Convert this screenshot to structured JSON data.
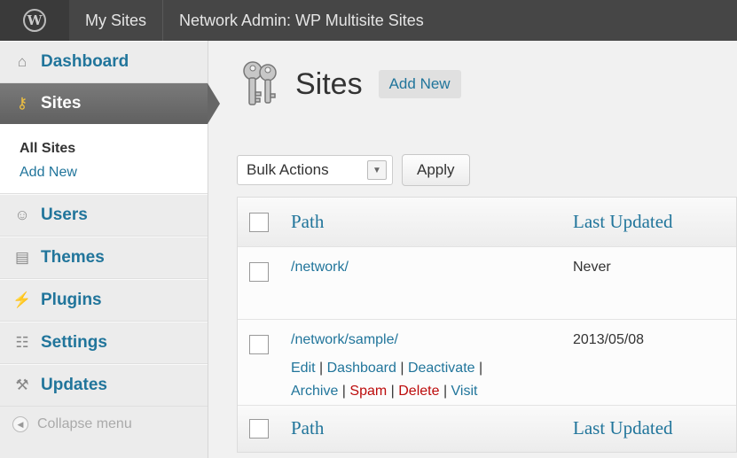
{
  "adminbar": {
    "logo_icon": "wordpress-logo-icon",
    "my_sites": "My Sites",
    "network_admin": "Network Admin: WP Multisite Sites"
  },
  "sidebar": {
    "items": [
      {
        "label": "Dashboard",
        "icon": "home-icon"
      },
      {
        "label": "Sites",
        "icon": "keys-icon",
        "active": true
      },
      {
        "label": "Users",
        "icon": "users-icon"
      },
      {
        "label": "Themes",
        "icon": "themes-icon"
      },
      {
        "label": "Plugins",
        "icon": "plug-icon"
      },
      {
        "label": "Settings",
        "icon": "settings-icon"
      },
      {
        "label": "Updates",
        "icon": "tools-icon"
      }
    ],
    "submenu": {
      "all_sites": "All Sites",
      "add_new": "Add New"
    },
    "collapse": "Collapse menu"
  },
  "page": {
    "title": "Sites",
    "add_new": "Add New",
    "bulk_actions": "Bulk Actions",
    "apply": "Apply"
  },
  "table": {
    "columns": {
      "path": "Path",
      "last_updated": "Last Updated"
    },
    "rows": [
      {
        "path": "/network/",
        "last_updated": "Never"
      },
      {
        "path": "/network/sample/",
        "last_updated": "2013/05/08",
        "actions": {
          "edit": "Edit",
          "dashboard": "Dashboard",
          "deactivate": "Deactivate",
          "archive": "Archive",
          "spam": "Spam",
          "delete": "Delete",
          "visit": "Visit"
        }
      }
    ]
  },
  "colors": {
    "link": "#21759b",
    "danger": "#bc0b0b",
    "adminbar": "#464646"
  }
}
